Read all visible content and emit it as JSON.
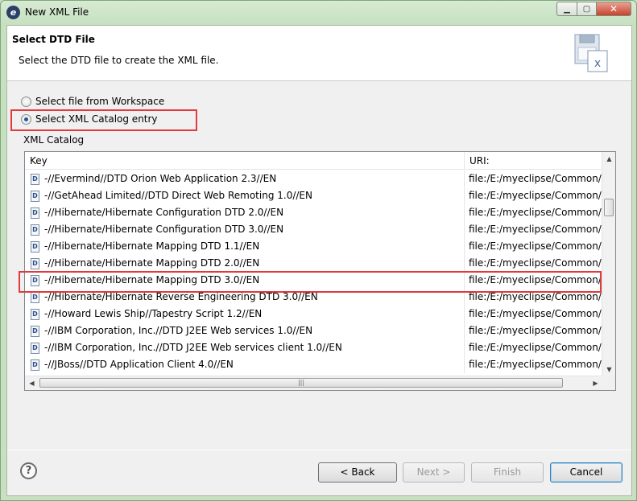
{
  "window": {
    "title": "New XML File",
    "app_icon": "eclipse-icon"
  },
  "header": {
    "title": "Select DTD File",
    "description": "Select the DTD file to create the XML file.",
    "icon": "xml-file-wizard-icon"
  },
  "options": {
    "workspace_label": "Select file from Workspace",
    "catalog_label": "Select XML Catalog entry",
    "selected": "catalog"
  },
  "catalog": {
    "label": "XML Catalog",
    "columns": {
      "key": "Key",
      "uri": "URI:"
    },
    "rows": [
      {
        "key": "-//Evermind//DTD Orion Web Application 2.3//EN",
        "uri": "file:/E:/myeclipse/Common/p"
      },
      {
        "key": "-//GetAhead Limited//DTD Direct Web Remoting 1.0//EN",
        "uri": "file:/E:/myeclipse/Common/p"
      },
      {
        "key": "-//Hibernate/Hibernate Configuration DTD 2.0//EN",
        "uri": "file:/E:/myeclipse/Common/p"
      },
      {
        "key": "-//Hibernate/Hibernate Configuration DTD 3.0//EN",
        "uri": "file:/E:/myeclipse/Common/p"
      },
      {
        "key": "-//Hibernate/Hibernate Mapping DTD 1.1//EN",
        "uri": "file:/E:/myeclipse/Common/p"
      },
      {
        "key": "-//Hibernate/Hibernate Mapping DTD 2.0//EN",
        "uri": "file:/E:/myeclipse/Common/p"
      },
      {
        "key": "-//Hibernate/Hibernate Mapping DTD 3.0//EN",
        "uri": "file:/E:/myeclipse/Common/p"
      },
      {
        "key": "-//Hibernate/Hibernate Reverse Engineering DTD 3.0//EN",
        "uri": "file:/E:/myeclipse/Common/p"
      },
      {
        "key": "-//Howard Lewis Ship//Tapestry Script 1.2//EN",
        "uri": "file:/E:/myeclipse/Common/p"
      },
      {
        "key": "-//IBM Corporation, Inc.//DTD J2EE Web services 1.0//EN",
        "uri": "file:/E:/myeclipse/Common/p"
      },
      {
        "key": "-//IBM Corporation, Inc.//DTD J2EE Web services client 1.0//EN",
        "uri": "file:/E:/myeclipse/Common/p"
      },
      {
        "key": "-//JBoss//DTD Application Client 4.0//EN",
        "uri": "file:/E:/myeclipse/Common/p"
      }
    ],
    "row_icon": "dtd-file-icon",
    "highlighted_row": "-//Hibernate/Hibernate Mapping DTD 3.0//EN"
  },
  "buttons": {
    "back": "< Back",
    "next": "Next >",
    "finish": "Finish",
    "cancel": "Cancel"
  },
  "colors": {
    "highlight_box": "#e0393e",
    "window_frame": "#c6e0c0"
  }
}
